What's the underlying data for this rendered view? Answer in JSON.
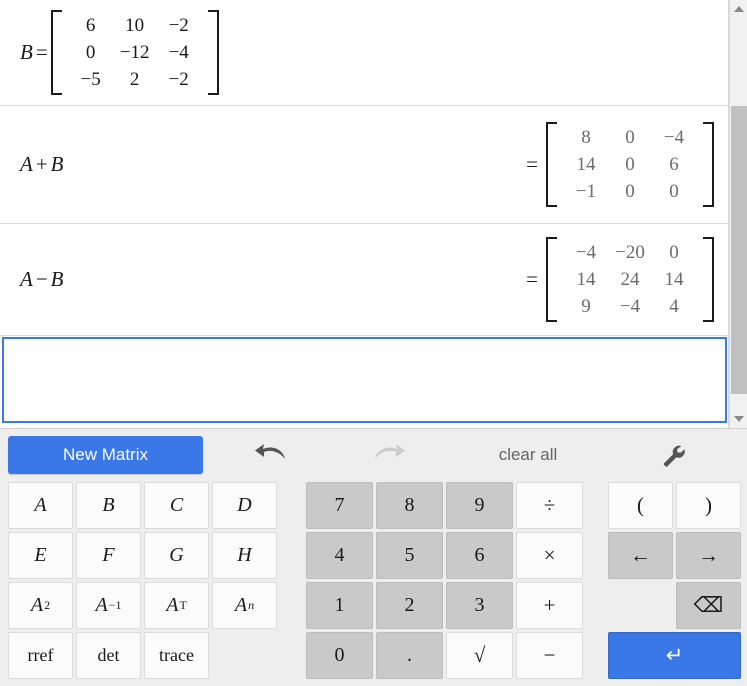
{
  "worksheet": {
    "rows": [
      {
        "id": "row-b",
        "label": "B",
        "label_op": "=",
        "eq": "",
        "matrix": [
          [
            "6",
            "10",
            "−2"
          ],
          [
            "0",
            "−12",
            "−4"
          ],
          [
            "−5",
            "2",
            "−2"
          ]
        ],
        "kind": "definition"
      },
      {
        "id": "row-sum",
        "label": "A",
        "label_op": "+",
        "label_b": "B",
        "eq": "=",
        "matrix": [
          [
            "8",
            "0",
            "−4"
          ],
          [
            "14",
            "0",
            "6"
          ],
          [
            "−1",
            "0",
            "0"
          ]
        ],
        "kind": "result"
      },
      {
        "id": "row-diff",
        "label": "A",
        "label_op": "−",
        "label_b": "B",
        "eq": "=",
        "matrix": [
          [
            "−4",
            "−20",
            "0"
          ],
          [
            "14",
            "24",
            "14"
          ],
          [
            "9",
            "−4",
            "4"
          ]
        ],
        "kind": "result"
      }
    ],
    "input_row": {
      "value": "",
      "placeholder": ""
    }
  },
  "toolbar": {
    "new_matrix_label": "New Matrix",
    "undo_icon": "undo-arrow-icon",
    "redo_icon": "redo-arrow-icon",
    "clear_all_label": "clear all",
    "settings_icon": "wrench-icon"
  },
  "keypad": {
    "matrix_keys": [
      {
        "label": "A",
        "style": "ital"
      },
      {
        "label": "B",
        "style": "ital"
      },
      {
        "label": "C",
        "style": "ital"
      },
      {
        "label": "D",
        "style": "ital"
      },
      {
        "label": "E",
        "style": "ital"
      },
      {
        "label": "F",
        "style": "ital"
      },
      {
        "label": "G",
        "style": "ital"
      },
      {
        "label": "H",
        "style": "ital"
      },
      {
        "label": "A",
        "sup": "2",
        "style": "ital"
      },
      {
        "label": "A",
        "sup": "−1",
        "style": "ital"
      },
      {
        "label": "A",
        "sup": "T",
        "style": "ital"
      },
      {
        "label": "A",
        "sup": "n",
        "sup_ital": true,
        "style": "ital"
      },
      {
        "label": "rref",
        "style": "text"
      },
      {
        "label": "det",
        "style": "text"
      },
      {
        "label": "trace",
        "style": "text"
      },
      {
        "label": "",
        "style": "blank"
      }
    ],
    "number_keys": [
      {
        "label": "7",
        "tone": "grey"
      },
      {
        "label": "8",
        "tone": "grey"
      },
      {
        "label": "9",
        "tone": "grey"
      },
      {
        "label": "÷",
        "tone": "white"
      },
      {
        "label": "4",
        "tone": "grey"
      },
      {
        "label": "5",
        "tone": "grey"
      },
      {
        "label": "6",
        "tone": "grey"
      },
      {
        "label": "×",
        "tone": "white"
      },
      {
        "label": "1",
        "tone": "grey"
      },
      {
        "label": "2",
        "tone": "grey"
      },
      {
        "label": "3",
        "tone": "grey"
      },
      {
        "label": "+",
        "tone": "white"
      },
      {
        "label": "0",
        "tone": "grey"
      },
      {
        "label": ".",
        "tone": "grey"
      },
      {
        "label": "√",
        "tone": "white"
      },
      {
        "label": "−",
        "tone": "white"
      }
    ],
    "edit_keys": [
      {
        "label": "(",
        "tone": "white",
        "name": "left-paren-key"
      },
      {
        "label": ")",
        "tone": "white",
        "name": "right-paren-key"
      },
      {
        "label": "←",
        "tone": "grey",
        "name": "cursor-left-key"
      },
      {
        "label": "→",
        "tone": "grey",
        "name": "cursor-right-key"
      }
    ],
    "backspace_label": "⌫",
    "enter_label": "↵"
  },
  "colors": {
    "accent_blue": "#3b78e7",
    "key_grey": "#c9c9c9",
    "key_white": "#fbfbfb",
    "panel_grey": "#eeeeee",
    "result_text": "#6b6b6b"
  }
}
